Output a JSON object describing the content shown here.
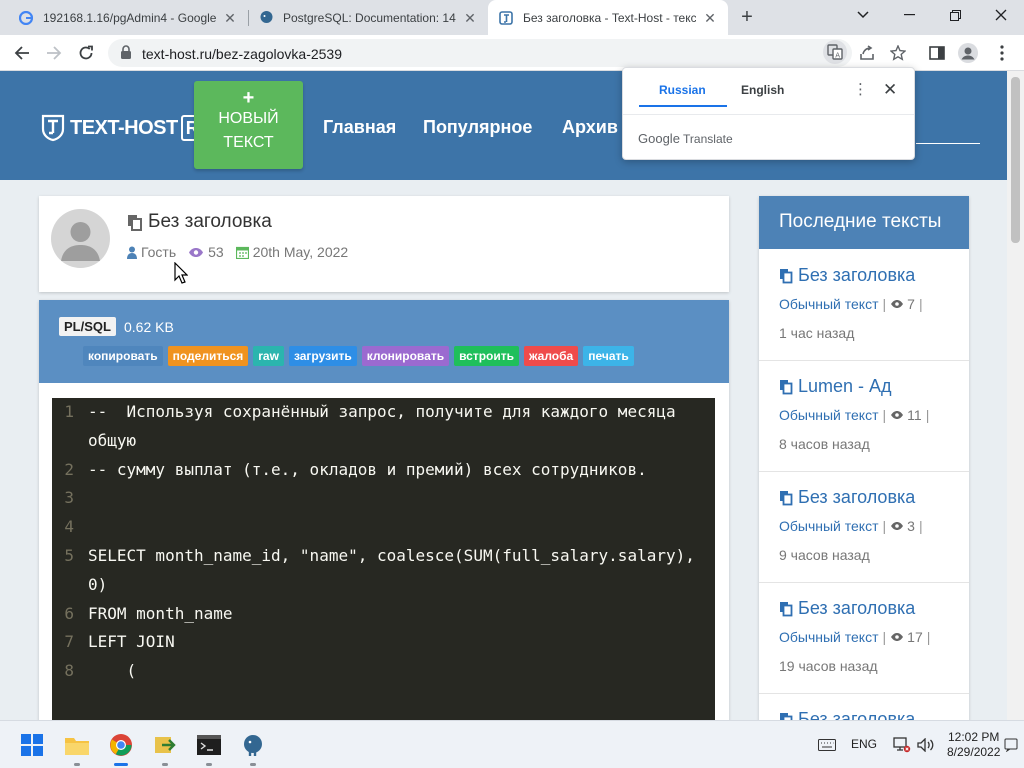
{
  "browser": {
    "tabs": [
      {
        "title": "192168.1.16/pgAdmin4 - Google",
        "icon": "google-icon",
        "active": false
      },
      {
        "title": "PostgreSQL: Documentation: 14:",
        "icon": "postgresql-icon",
        "active": false
      },
      {
        "title": "Без заголовка - Text-Host - текс",
        "icon": "text-host-icon",
        "active": true
      }
    ],
    "url": "text-host.ru/bez-zagolovka-2539"
  },
  "translate_popup": {
    "lang_source": "Russian",
    "lang_target": "English",
    "brand_google": "Google",
    "brand_translate": "Translate"
  },
  "site": {
    "logo_text": "TEXT-HOST",
    "logo_badge": "RU",
    "new_button": {
      "plus": "+",
      "line1": "НОВЫЙ",
      "line2": "ТЕКСТ"
    },
    "nav": [
      "Главная",
      "Популярное",
      "Архив"
    ]
  },
  "post": {
    "title": "Без заголовка",
    "author": "Гость",
    "views": "53",
    "date": "20th May, 2022"
  },
  "paste": {
    "language": "PL/SQL",
    "size": "0.62 KB",
    "actions": [
      {
        "label": "копировать",
        "color": "#4f86bd"
      },
      {
        "label": "поделиться",
        "color": "#f0931f"
      },
      {
        "label": "raw",
        "color": "#2bb5ae"
      },
      {
        "label": "загрузить",
        "color": "#2e8ee6"
      },
      {
        "label": "клонировать",
        "color": "#9b6ad0"
      },
      {
        "label": "встроить",
        "color": "#1fbf5b"
      },
      {
        "label": "жалоба",
        "color": "#ef4b4b"
      },
      {
        "label": "печать",
        "color": "#3cb4e8"
      }
    ],
    "code_lines": [
      {
        "num": "1",
        "text": "--  Используя сохранённый запрос, получите для каждого месяца общую"
      },
      {
        "num": "2",
        "text": "-- сумму выплат (т.е., окладов и премий) всех сотрудников."
      },
      {
        "num": "3",
        "text": ""
      },
      {
        "num": "4",
        "text": ""
      },
      {
        "num": "5",
        "text": "SELECT month_name_id, \"name\", coalesce(SUM(full_salary.salary), 0)"
      },
      {
        "num": "6",
        "text": "FROM month_name"
      },
      {
        "num": "7",
        "text": "LEFT JOIN"
      },
      {
        "num": "8",
        "text": "    ("
      }
    ]
  },
  "sidebar": {
    "heading": "Последние тексты",
    "items": [
      {
        "title": "Без заголовка",
        "type": "Обычный текст",
        "views": "7",
        "ago": "1 час назад"
      },
      {
        "title": "Lumen - Ад",
        "type": "Обычный текст",
        "views": "11",
        "ago": "8 часов назад"
      },
      {
        "title": "Без заголовка",
        "type": "Обычный текст",
        "views": "3",
        "ago": "9 часов назад"
      },
      {
        "title": "Без заголовка",
        "type": "Обычный текст",
        "views": "17",
        "ago": "19 часов назад"
      },
      {
        "title": "Без заголовка",
        "type": "",
        "views": "",
        "ago": ""
      }
    ]
  },
  "taskbar": {
    "language": "ENG",
    "time": "12:02 PM",
    "date": "8/29/2022"
  }
}
